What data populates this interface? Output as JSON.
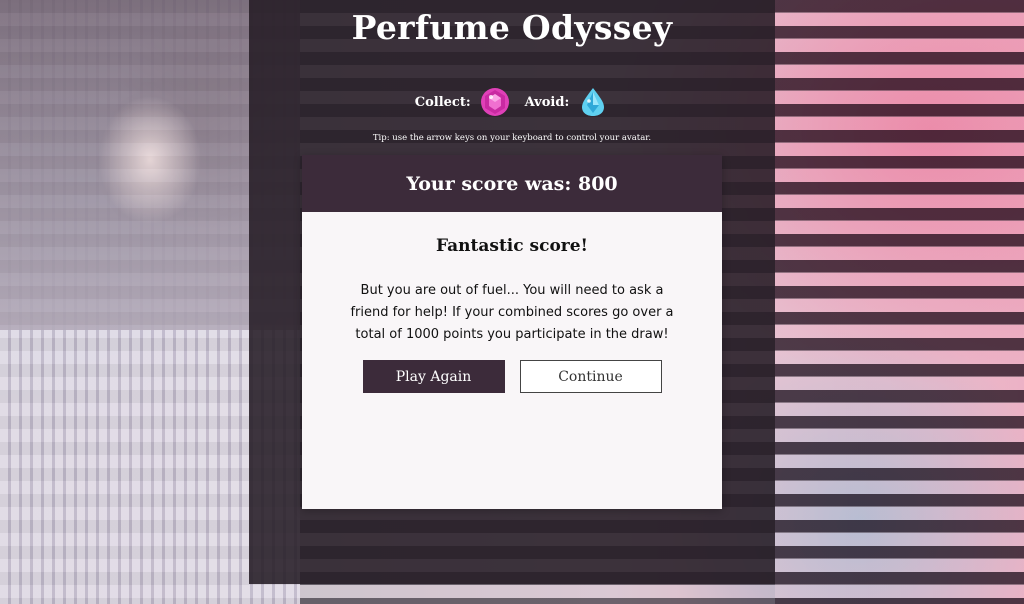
{
  "game": {
    "title": "Perfume Odyssey",
    "legend": {
      "collect_label": "Collect:",
      "collect_icon": "pink-gem-icon",
      "avoid_label": "Avoid:",
      "avoid_icon": "blue-drop-gem-icon"
    },
    "tip": "Tip: use the arrow keys on your keyboard to control your avatar."
  },
  "result_dialog": {
    "score_text": "Your score was: 800",
    "heading": "Fantastic score!",
    "message": "But you are out of fuel... You will need to ask a friend for help! If your combined scores go over a total of 1000 points you participate in the draw!",
    "play_again_label": "Play Again",
    "continue_label": "Continue"
  },
  "colors": {
    "panel_dark": "#3c2b3a",
    "gem_pink": "#e040b8",
    "gem_blue": "#5fd0f0",
    "dialog_bg": "#f9f6f8"
  }
}
